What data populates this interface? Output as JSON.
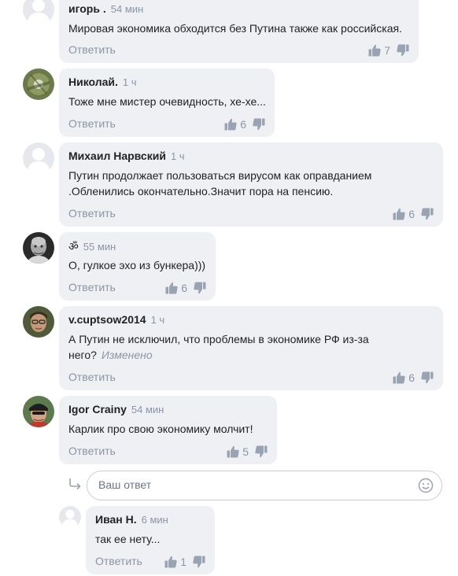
{
  "comments": [
    {
      "author": "игорь .",
      "time": "54 мин",
      "text": [
        "Мировая экономика  обходится без Путина также как российская."
      ],
      "reply_label": "Ответить",
      "likes": "7"
    },
    {
      "author": "Николай.",
      "time": "1 ч",
      "text": [
        "Тоже мне мистер очевидность, хе-хе..."
      ],
      "reply_label": "Ответить",
      "likes": "6"
    },
    {
      "author": "Михаил Нарвский",
      "time": "1 ч",
      "text": [
        "Путин продолжает пользоваться вирусом как оправданием",
        ".Обленились окончательно.Значит пора на пенсию."
      ],
      "reply_label": "Ответить",
      "likes": "6"
    },
    {
      "author": "ॐ",
      "time": "55 мин",
      "text": [
        "О, гулкое эхо из бункера)))"
      ],
      "reply_label": "Ответить",
      "likes": "6"
    },
    {
      "author": "v.cuptsow2014",
      "time": "1 ч",
      "text": [
        "А Путин не исключил, что проблемы в экономике РФ из-за",
        "него?"
      ],
      "edited": "Изменено",
      "reply_label": "Ответить",
      "likes": "6"
    },
    {
      "author": "Igor Crainy",
      "time": "54 мин",
      "text": [
        "Карлик про свою экономику молчит!"
      ],
      "reply_label": "Ответить",
      "likes": "5"
    }
  ],
  "reply_box": {
    "placeholder": "Ваш ответ"
  },
  "nested_reply": {
    "author": "Иван Н.",
    "time": "6 мин",
    "text": "так ее нету...",
    "reply_label": "Ответить",
    "likes": "1"
  },
  "icons": {
    "like": "thumbs-up-icon",
    "dislike": "thumbs-down-icon",
    "reply_arrow": "reply-arrow-icon",
    "emoji": "smile-icon"
  },
  "colors": {
    "bubble": "#eef0f4",
    "muted": "#8c95a6",
    "icon": "#9aa3b2"
  }
}
